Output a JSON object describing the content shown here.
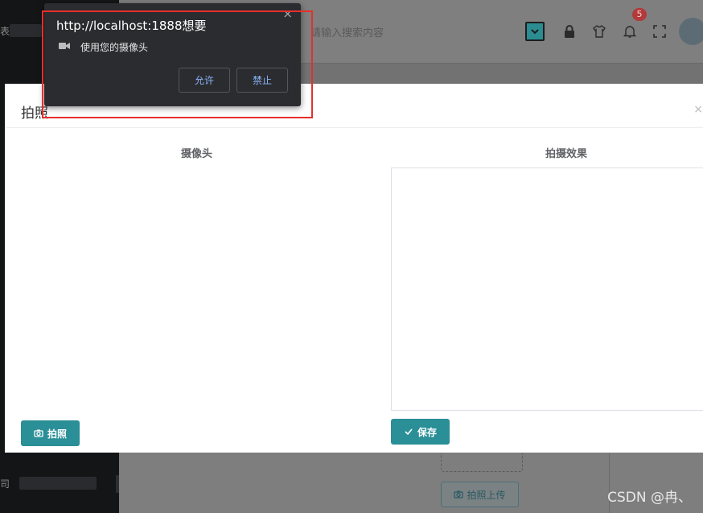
{
  "header": {
    "search_placeholder": "请输入搜索内容",
    "notification_count": "5",
    "icons": [
      "lock-icon",
      "shirt-icon",
      "bell-icon",
      "fullscreen-icon"
    ]
  },
  "sidebar": {
    "fragment_top": "表",
    "fragment_bottom": "司"
  },
  "background": {
    "upload_button_label": "拍照上传"
  },
  "modal": {
    "title": "拍照",
    "close": "×",
    "camera_label": "摄像头",
    "result_label": "拍摄效果",
    "capture_button": "拍照",
    "save_button": "保存"
  },
  "permission_popup": {
    "title": "http://localhost:1888想要",
    "message": "使用您的摄像头",
    "allow_button": "允许",
    "block_button": "禁止",
    "close": "×"
  },
  "watermark": "CSDN @冉、",
  "colors": {
    "accent": "#2a8f97",
    "highlight": "#e5302c",
    "popup_bg": "#2b2c30",
    "popup_button_text": "#8ab4f8"
  }
}
